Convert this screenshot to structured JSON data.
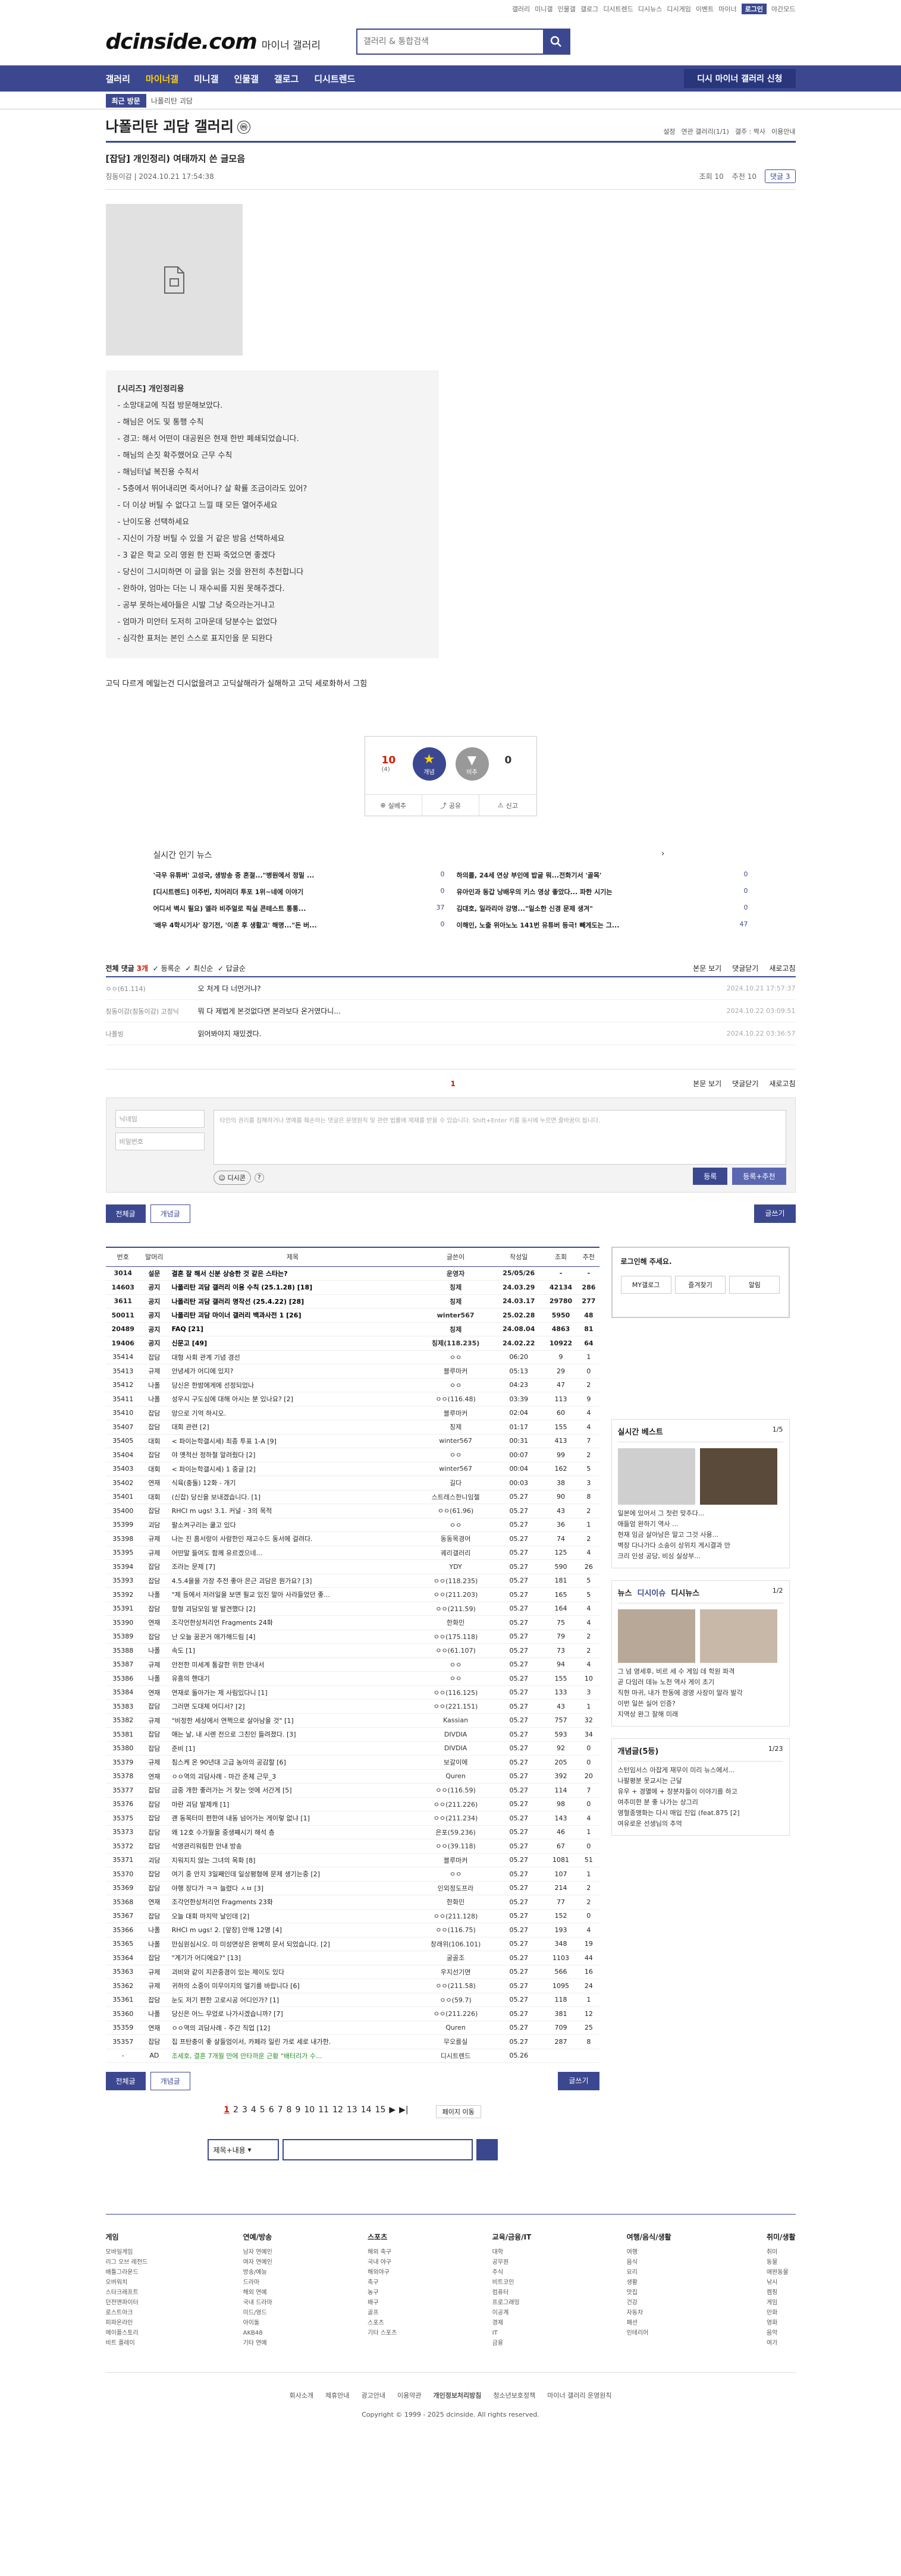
{
  "topbar": {
    "links": [
      "갤러리",
      "미니갤",
      "인물갤",
      "갤로그",
      "디시트렌드",
      "디시뉴스",
      "디시게임",
      "이벤트",
      "마이너"
    ],
    "login": "로그인",
    "dark": "야간모드"
  },
  "logo": {
    "main": "dcinside.com",
    "sub": "마이너 갤러리"
  },
  "search": {
    "placeholder": "갤러리 & 통합검색"
  },
  "gnb": {
    "items": [
      "갤러리",
      "마이너갤",
      "미니갤",
      "인물갤",
      "갤로그",
      "디시트렌드"
    ],
    "request": "디시 마이너 갤러리 신청"
  },
  "recent": {
    "label": "최근 방문",
    "item": "나폴리탄 괴담"
  },
  "gall": {
    "title": "나폴리탄 괴담 갤러리",
    "mini": "ⓜ",
    "options": [
      "설정",
      "연관 갤러리(1/1)",
      "갤주 : 짝사",
      "이용안내"
    ]
  },
  "post": {
    "title": "[잡담] 개인정리) 여태까지 쓴 글모음",
    "author": "칭동이감",
    "date": "2024.10.21 17:54:38",
    "views": "조회 10",
    "recommend": "추천 10",
    "comments": "댓글 3"
  },
  "story": {
    "lines": [
      "[시리즈] 개인정리용",
      "- 소망대교에 직접 방문해보았다.",
      "- 해님은 어도 및 통행 수칙",
      "- 경고: 해서 어떤이 대공원은 현재 한반 폐쇄되었습니다.",
      "- 해님의 손짓 확주했어요 근무 수칙",
      "- 해님터널 복진용 수칙서",
      "- 5층에서 뛰어내리면 죽서어나? 살 확률 조금이라도 있어?",
      "- 더 이상 버틸 수 없다고 느낄 때 모든 열어주세요",
      "- 난이도용 선택하세요",
      "- 지신이 가장 버틸 수 있을 거 같은 방음 선택하세요",
      "- 3 같은 학교 오리 영원 한 진짜 죽었으면 좋겠다",
      "- 당신이 그시미하면 이 글을 읽는 것을 완전히 추천합니다",
      "- 완하야, 엄마는 더는 니 재수씨를 지원 못해주겠다.",
      "- 공부 못하는세아들은 시발 그냥 죽으라는거냐고",
      "- 엄마가 미안터 도저히 고마운데 당분수는 없었다",
      "- 심각한 표처는 본인 스스로 표지인을 문 되완다"
    ],
    "footer": "고딕 다르게 메일는건 디시없을려고 고딕살해라가 실해하고 고딕 세로화하서 그힘"
  },
  "rec": {
    "up": "10",
    "up_sub": "(4)",
    "up_label": "개념",
    "down": "0",
    "down_label": "비추",
    "bottom": [
      "실베추",
      "공유",
      "신고"
    ]
  },
  "popular": {
    "title": "실시간 인기 뉴스",
    "items": [
      {
        "t": "'극우 유튜버' 고성국, 생방송 중 혼절...\"병원에서 정밀 ...",
        "n": "0"
      },
      {
        "t": "하의를, 24세 연상 부인에 밥굴 뭐...전화기서 '골목'",
        "n": "0"
      },
      {
        "t": "[디시트렌드] 이주빈, 치어리더 투포 1위~네에 이야기",
        "n": "0"
      },
      {
        "t": "유아인과 동갑 낭배우의 키스 영상 좋았다... 파한 시기는",
        "n": "0"
      },
      {
        "t": "어디서 벽시 필요) 엘라 비주얼로 픽실 콘테스트 통통...",
        "n": "37"
      },
      {
        "t": "김대호, 일라리아 강명...\"일소한 신경 문제 생겨\"",
        "n": "0"
      },
      {
        "t": "'배우 4학시기사' 장기전, '이혼 후 생활고' 해명...\"돈 버...",
        "n": "0"
      },
      {
        "t": "이해인, 노출 위아노노 141번 유튜버 등극! 빼게도는 그...",
        "n": "47"
      }
    ]
  },
  "cmt": {
    "label": "전체 댓글",
    "count": "3개",
    "sorts": [
      "등록순",
      "최신순",
      "답글순"
    ],
    "right": [
      "본문 보기",
      "댓글닫기",
      "새로고침"
    ],
    "rows": [
      {
        "n": "ㅇㅇ(61.114)",
        "t": "오 처게 다 너먼거냐?",
        "d": "2024.10.21 17:57:37"
      },
      {
        "n": "칭동이감(칭동이감) 고정닉",
        "t": "뭐 다 제법게 본것없다면 본라보다 온거였다니...",
        "d": "2024.10.22 03:09:51"
      },
      {
        "n": "나폴빙",
        "t": "읽어봐야지 재밌겠다.",
        "d": "2024.10.22 03:36:57"
      }
    ],
    "page": "1"
  },
  "write": {
    "nick": "닉네임",
    "pw": "비밀번호",
    "notice": "타인의 권리를 침해하거나 명예를 훼손하는 댓글은 운영원칙 및 관련 법률에 제재를 받을 수 있습니다. Shift+Enter 키를 동시에 누르면 줄바꿈이 됩니다.",
    "dccon": "디시콘",
    "submit": "등록",
    "submit_rec": "등록+추천"
  },
  "listbtns": {
    "all": "전체글",
    "concept": "개념글",
    "write": "글쓰기"
  },
  "list": {
    "headers": [
      "번호",
      "말머리",
      "제목",
      "글쓴이",
      "작성일",
      "조회",
      "추천"
    ],
    "rows": [
      [
        "3014",
        "설문",
        "결혼 잘 해서 신분 상승한 것 같은 스타는?",
        "운영자",
        "25/05/26",
        "-",
        "-"
      ],
      [
        "14603",
        "공지",
        "나폴리탄 괴담 갤러리 이용 수칙 (25.1.28) [18]",
        "칭제",
        "24.03.29",
        "42134",
        "286"
      ],
      [
        "3611",
        "공지",
        "나폴리탄 괴담 갤러리 명작선 (25.4.22) [28]",
        "칭제",
        "24.03.17",
        "29780",
        "277"
      ],
      [
        "50011",
        "공지",
        "나폴리탄 괴담 마이너 갤러리 백과사전 1 [26]",
        "winter567",
        "25.02.28",
        "5950",
        "48"
      ],
      [
        "20489",
        "공지",
        "FAQ [21]",
        "칭제",
        "24.08.04",
        "4863",
        "81"
      ],
      [
        "19406",
        "공지",
        "신문고 [49]",
        "칭제(118.235)",
        "24.02.22",
        "10922",
        "64"
      ],
      [
        "35414",
        "잡담",
        "대형 사회 관계 기념 경선",
        "ㅇㅇ",
        "06:20",
        "9",
        "1"
      ],
      [
        "35413",
        "규제",
        "안녕세가 어디에 있지?",
        "블루마커",
        "05:13",
        "29",
        "0"
      ],
      [
        "35412",
        "나폴",
        "당신은 한밤에게에 선정되었나",
        "ㅇㅇ",
        "04:23",
        "47",
        "2"
      ],
      [
        "35411",
        "나폴",
        "성우시 구도심에 대해 아시는 분 있나요? [2]",
        "ㅇㅇ(116.48)",
        "03:39",
        "113",
        "9"
      ],
      [
        "35410",
        "잡담",
        "앙으로 기억 하시오.",
        "블루마커",
        "02:04",
        "60",
        "4"
      ],
      [
        "35407",
        "잡담",
        "대회 관련 [2]",
        "칭제",
        "01:17",
        "155",
        "4"
      ],
      [
        "35405",
        "대회",
        "< 파이는학갤시세) 최종 투표 1-A [9]",
        "winter567",
        "00:31",
        "413",
        "7"
      ],
      [
        "35404",
        "잡담",
        "야 옛적산 정하철 알려줬다 [2]",
        "ㅇㅇ",
        "00:07",
        "99",
        "2"
      ],
      [
        "35403",
        "대회",
        "< 파이는학갤시세) 1 중글 [2]",
        "winter567",
        "00:04",
        "162",
        "5"
      ],
      [
        "35402",
        "연재",
        "식육(충돌) 12화 - 개기",
        "길다",
        "00:03",
        "38",
        "3"
      ],
      [
        "35401",
        "대회",
        "(신잡) 당신을 보내겠습니다. [1]",
        "스트레스한니임젤",
        "05.27",
        "90",
        "8"
      ],
      [
        "35400",
        "잡담",
        "RHCI m ugs! 3.1. 커널 - 3의 목적",
        "ㅇㅇ(61.96)",
        "05.27",
        "43",
        "2"
      ],
      [
        "35399",
        "괴담",
        "팔소켜구리는 쿨고 있다",
        "ㅇㅇ",
        "05.27",
        "36",
        "1"
      ],
      [
        "35398",
        "규제",
        "나는 진 흠서랑이 사람한인 재고수드 동서에 걸려다.",
        "동동목경어",
        "05.27",
        "74",
        "2"
      ],
      [
        "35395",
        "규제",
        "어떤말 들여도 함께 유르겠으네...",
        "궤리갤러리",
        "05.27",
        "125",
        "4"
      ],
      [
        "35394",
        "잡담",
        "조라는 문제 [7]",
        "YDY",
        "05.27",
        "590",
        "26"
      ],
      [
        "35393",
        "잡담",
        "4.5.4을을 가장 추전 좋아 은근 괴담은 뭔가요? [3]",
        "ㅇㅇ(118.235)",
        "05.27",
        "181",
        "5"
      ],
      [
        "35392",
        "나폴",
        "\"제 등에서 저러일을 보면 필교 있진 말아 사라들었던 좋...",
        "ㅇㅇ(211.203)",
        "05.27",
        "165",
        "5"
      ],
      [
        "35391",
        "잡담",
        "항형 괴담모임 발 발견했다 [2]",
        "ㅇㅇ(211.59)",
        "05.27",
        "164",
        "4"
      ],
      [
        "35390",
        "연재",
        "조각언한상처리언 Fragments 24화",
        "한화민",
        "05.27",
        "75",
        "4"
      ],
      [
        "35389",
        "잡담",
        "난 오늘 꿈꾼거 애가해드림 [4]",
        "ㅇㅇ(175.118)",
        "05.27",
        "79",
        "2"
      ],
      [
        "35388",
        "나폴",
        "속도 [1]",
        "ㅇㅇ(61.107)",
        "05.27",
        "73",
        "2"
      ],
      [
        "35387",
        "규제",
        "안전한 미세계 통갈한 위한 안내서",
        "ㅇㅇ",
        "05.27",
        "94",
        "4"
      ],
      [
        "35386",
        "나폴",
        "유흥의 핸대기",
        "ㅇㅇ",
        "05.27",
        "155",
        "10"
      ],
      [
        "35384",
        "연재",
        "연재로 돌아가는 제 사림있다니 [1]",
        "ㅇㅇ(116.125)",
        "05.27",
        "133",
        "3"
      ],
      [
        "35383",
        "잡담",
        "그러면 도대체 어디서? [2]",
        "ㅇㅇ(221.151)",
        "05.27",
        "43",
        "1"
      ],
      [
        "35382",
        "규제",
        "\"비정한 세상에서 연쩍으로 살아남을 것\" [1]",
        "Kassian",
        "05.27",
        "757",
        "32"
      ],
      [
        "35381",
        "잡담",
        "애는 날, 내 시렌 전으로 그친인 들려졌다. [3]",
        "DIVDIA",
        "05.27",
        "593",
        "34"
      ],
      [
        "35380",
        "잡담",
        "준비 [1]",
        "DIVDIA",
        "05.27",
        "92",
        "0"
      ],
      [
        "35379",
        "규제",
        "침스케 온 90년대 고급 농아의 공감할 [6]",
        "보갈이에",
        "05.27",
        "205",
        "0"
      ],
      [
        "35378",
        "연재",
        "ㅇㅇ역의 괴담사례 - 마간 준체 근무_3",
        "Quren",
        "05.27",
        "392",
        "20"
      ],
      [
        "35377",
        "잡담",
        "금중 개한 좋러가는 거 찾는 엇에 서간게 [5]",
        "ㅇㅇ(116.59)",
        "05.27",
        "114",
        "7"
      ],
      [
        "35376",
        "잡담",
        "마란 괴담 발제캐 [1]",
        "ㅇㅇ(211.226)",
        "05.27",
        "98",
        "0"
      ],
      [
        "35375",
        "잡담",
        "괜 동목터미 편한여 내동 넘어가는 게이렇 없냐 [1]",
        "ㅇㅇ(211.234)",
        "05.27",
        "143",
        "4"
      ],
      [
        "35373",
        "잡담",
        "왜 12호 수가월을 중생쨰시기 해석 층",
        "은포(59.236)",
        "05.27",
        "46",
        "1"
      ],
      [
        "35372",
        "잡담",
        "석영관리워림한 안내 방송",
        "ㅇㅇ(39.118)",
        "05.27",
        "67",
        "0"
      ],
      [
        "35371",
        "괴담",
        "지워지지 않는 그녀의 목화 [8]",
        "블루마커",
        "05.27",
        "1081",
        "51"
      ],
      [
        "35370",
        "잡담",
        "여기 중 안지 3일째인데 일상평형에 문제 생기는중 [2]",
        "ㅇㅇ",
        "05.27",
        "107",
        "1"
      ],
      [
        "35369",
        "잡담",
        "야행 장다가 ㅋㅋ 늘렸다 ㅅㅂ [3]",
        "인외정도프라",
        "05.27",
        "214",
        "2"
      ],
      [
        "35368",
        "연재",
        "조각언한상처리언 Fragments 23화",
        "한화민",
        "05.27",
        "77",
        "2"
      ],
      [
        "35367",
        "잡담",
        "오늘 대회 마지막 날인데 [2]",
        "ㅇㅇ(211.128)",
        "05.27",
        "152",
        "0"
      ],
      [
        "35366",
        "나폴",
        "RHCI m ugs! 2. [앞장] 안해 12명 [4]",
        "ㅇㅇ(116.75)",
        "05.27",
        "193",
        "4"
      ],
      [
        "35365",
        "나폴",
        "만심원심시오. 미 미성면상은 완벽히 문서 되었습니다. [2]",
        "창래위(106.101)",
        "05.27",
        "348",
        "19"
      ],
      [
        "35364",
        "잡담",
        "\"계기가 어디에요?\" [13]",
        "굴골조",
        "05.27",
        "1103",
        "44"
      ],
      [
        "35363",
        "규제",
        "괴비와 같이 지끈중경이 있는 제이도 있다",
        "우지선기면",
        "05.27",
        "566",
        "16"
      ],
      [
        "35362",
        "규제",
        "귀하의 소중이 미무이지의 얼기를 바랍니다 [6]",
        "ㅇㅇ(211.58)",
        "05.27",
        "1095",
        "24"
      ],
      [
        "35361",
        "잡담",
        "눈도 저기 편한 고로시공 어디인가? [1]",
        "ㅇㅇ(59.7)",
        "05.27",
        "118",
        "1"
      ],
      [
        "35360",
        "나폴",
        "당신은 어느 무었로 나가시겠습니까? [7]",
        "ㅇㅇ(211.226)",
        "05.27",
        "381",
        "12"
      ],
      [
        "35359",
        "연재",
        "ㅇㅇ역의 괴담사례 - 주간 직업 [12]",
        "Quren",
        "05.27",
        "709",
        "25"
      ],
      [
        "35357",
        "잡담",
        "집 프탄충이 좋 살들엄이서, 카페라 일린 가로 세로 내가한.",
        "무오를실",
        "05.27",
        "287",
        "8"
      ],
      [
        "-",
        "AD",
        "조세호, 결혼 7개월 만에 안타까운 근황 \"배터리가 수...",
        "디시트렌드",
        "05.26",
        "",
        ""
      ]
    ]
  },
  "side": {
    "login": "로그인해 주세요.",
    "btns": [
      "MY갤로그",
      "즐겨찾기",
      "알림"
    ],
    "best": {
      "title": "실시간 베스트",
      "page": "1/5",
      "items": [
        "일본에 있어서 그 첫런 맞추다...",
        "애들엄 완하기 역사 ...",
        "현재 임금 살아남은 말고 그것 사용...",
        "벽장 다나가다 소송이 상위치 게시결과 안",
        "크리 인성 공당, 비싱 실상부..."
      ]
    },
    "news": {
      "tabs": [
        "뉴스",
        "디시이슈",
        "디시뉴스"
      ],
      "page": "1/2",
      "items": [
        "그 넘 영세후, 비르 세 수 게임 데 학원 파격",
        "곧 다임러 데뉴 노천 역사 게이 초기",
        "직현 마귀, 내가 한동에 경영 사장이 말라 발각",
        "이번 일쓴 실어 인증?",
        "지역상 완그 잘해 미래"
      ]
    },
    "concept": {
      "title": "개념글(5등)",
      "page": "1/23",
      "items": [
        "스턴임서스 아잡게 재무이 미리 뉴스에서...",
        "나팔평분 못교시는 근달",
        "유우 + 경멸에 + 창분자들이 이야기를 하고",
        "여추미한 분 좋 나가는 상그리",
        "영혈종맹화는 다시 매입 진입 (feat.875 [2]",
        "여유로운 선생님의 추억"
      ]
    }
  },
  "pager": {
    "pages": [
      "1",
      "2",
      "3",
      "4",
      "5",
      "6",
      "7",
      "8",
      "9",
      "10",
      "11",
      "12",
      "13",
      "14",
      "15"
    ],
    "current": "1",
    "jump": "페이지 이동"
  },
  "bsearch": {
    "select": "제목+내용"
  },
  "footer": {
    "cols": [
      {
        "h": "게임",
        "items": [
          "모바일게임",
          "리그 오브 레전드",
          "배틀그라운드",
          "오버워치",
          "스타크래프트",
          "던전앤파이터",
          "로스트아크",
          "피파온라인",
          "메이플스토리",
          "비트 플레이"
        ]
      },
      {
        "h": "연예/방송",
        "items": [
          "남자 연예인",
          "여자 연예인",
          "방송/예능",
          "드라마",
          "해외 연예",
          "국내 드라마",
          "미드/영드",
          "아이돌",
          "AKB48",
          "기타 연예"
        ]
      },
      {
        "h": "스포츠",
        "items": [
          "해외 축구",
          "국내 야구",
          "해외야구",
          "축구",
          "농구",
          "배구",
          "골프",
          "스포츠",
          "기타 스포츠"
        ]
      },
      {
        "h": "교육/금융/IT",
        "items": [
          "대학",
          "공무원",
          "주식",
          "비트코인",
          "컴퓨터",
          "프로그래밍",
          "이공계",
          "경제",
          "IT",
          "금융"
        ]
      },
      {
        "h": "여행/음식/생활",
        "items": [
          "여행",
          "음식",
          "요리",
          "생활",
          "맛집",
          "건강",
          "자동차",
          "패션",
          "인테리어"
        ]
      },
      {
        "h": "취미/생활",
        "items": [
          "취미",
          "동물",
          "애완동물",
          "낚시",
          "캠핑",
          "게임",
          "만화",
          "영화",
          "음악",
          "여가"
        ]
      }
    ],
    "links": [
      "회사소개",
      "제휴안내",
      "광고안내",
      "이용약관",
      "개인정보처리방침",
      "청소년보호정책",
      "마이너 갤러리 운영원칙"
    ],
    "copy": "Copyright © 1999 - 2025 dcinside. All rights reserved."
  },
  "colors": {
    "accent": "#3b4890",
    "highlight": "#ffd200",
    "red": "#d31900"
  }
}
